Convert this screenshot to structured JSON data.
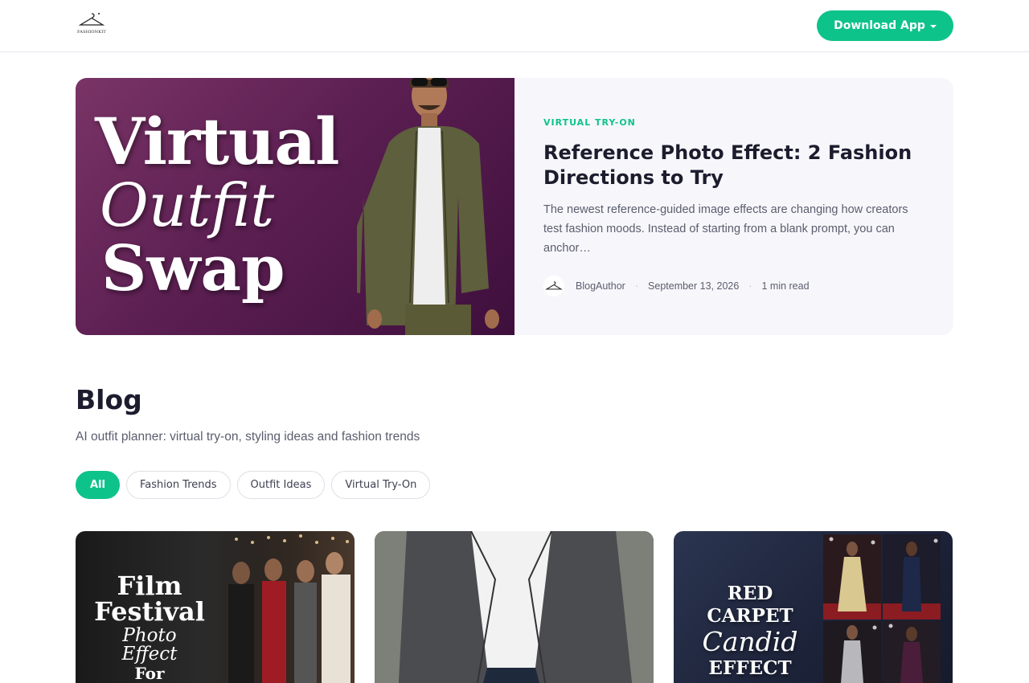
{
  "header": {
    "logo_text": "FASHIONKIT",
    "download_label": "Download App"
  },
  "featured": {
    "image_text": {
      "line1": "Virtual",
      "line2": "Outfit",
      "line3": "Swap"
    },
    "category": "VIRTUAL TRY-ON",
    "title": "Reference Photo Effect: 2 Fashion Directions to Try",
    "excerpt": "The newest reference-guided image effects are changing how creators test fashion moods. Instead of starting from a blank prompt, you can anchor…",
    "author": "BlogAuthor",
    "date": "September 13, 2026",
    "read_time": "1 min read"
  },
  "blog": {
    "title": "Blog",
    "subtitle": "AI outfit planner: virtual try-on, styling ideas and fashion trends",
    "filters": [
      "All",
      "Fashion Trends",
      "Outfit Ideas",
      "Virtual Try-On"
    ],
    "active_filter": "All"
  },
  "cards": [
    {
      "image_text": {
        "line1": "Film",
        "line2": "Festival",
        "line3": "Photo Effect",
        "line4": "For Creators"
      }
    },
    {
      "image_text": {}
    },
    {
      "image_text": {
        "line1": "RED CARPET",
        "line2": "Candid",
        "line3": "EFFECT"
      }
    }
  ],
  "colors": {
    "accent": "#0ec38a",
    "featured_bg": "#5c1f52"
  }
}
